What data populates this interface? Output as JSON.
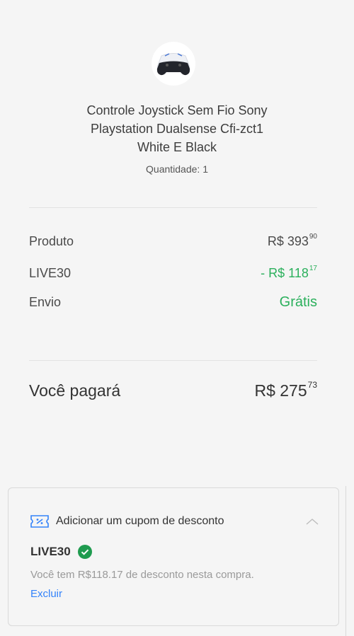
{
  "product": {
    "image_icon": "gamepad-icon",
    "title_lines": [
      "Controle Joystick Sem Fio Sony",
      "Playstation Dualsense Cfi-zct1",
      "White E Black"
    ],
    "quantity": "Quantidade: 1"
  },
  "summary": {
    "product_label": "Produto",
    "product_price_int": "R$ 393",
    "product_price_cents": "90",
    "coupon_label": "LIVE30",
    "coupon_discount_int": "- R$ 118",
    "coupon_discount_cents": "17",
    "shipping_label": "Envio",
    "shipping_value": "Grátis",
    "total_label": "Você pagará",
    "total_int": "R$ 275",
    "total_cents": "73"
  },
  "coupon": {
    "header_icon": "coupon-ticket-icon",
    "header_label": "Adicionar um cupom de desconto",
    "code": "LIVE30",
    "status_icon": "check-circle-icon",
    "description": "Você tem R$118.17 de desconto nesta compra.",
    "remove_label": "Excluir"
  },
  "colors": {
    "accent_green": "#2bb05c",
    "link_blue": "#3483fa",
    "background": "#f5f5f5"
  }
}
